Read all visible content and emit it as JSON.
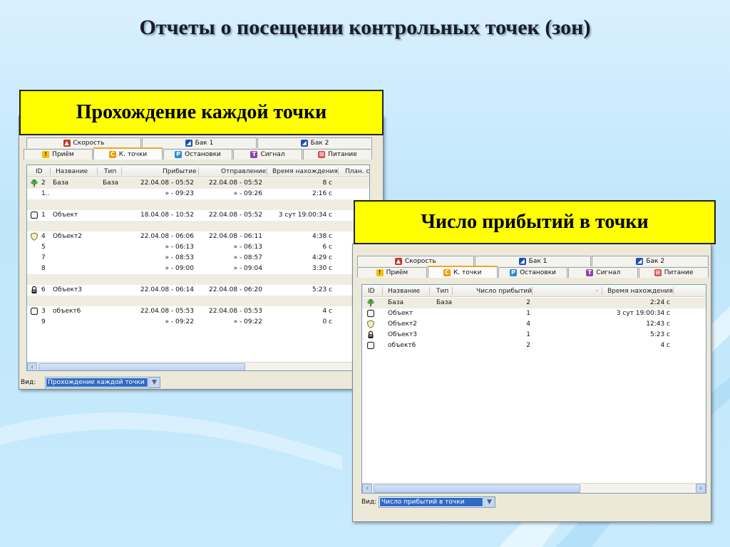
{
  "slide": {
    "title": "Отчеты о посещении контрольных точек (зон)",
    "banner_left": "Прохождение каждой точки",
    "banner_right": "Число прибытий в точки"
  },
  "tabs_top": [
    {
      "label": "Скорость",
      "icon": "speed-icon",
      "color": "#c0392b"
    },
    {
      "label": "Бак 1",
      "icon": "tank-icon",
      "color": "#1f4fb4"
    },
    {
      "label": "Бак 2",
      "icon": "tank-icon",
      "color": "#1f4fb4"
    }
  ],
  "tabs_bottom": [
    {
      "label": "Приём",
      "icon": "exclamation-icon",
      "glyph": "!",
      "color": "#f2c200"
    },
    {
      "label": "К. точки",
      "icon": "checkpoint-icon",
      "glyph": "C",
      "color": "#f29a00",
      "active": true
    },
    {
      "label": "Остановки",
      "icon": "parking-icon",
      "glyph": "P",
      "color": "#2a8bd8"
    },
    {
      "label": "Сигнал",
      "icon": "signal-icon",
      "glyph": "T",
      "color": "#8e44ad"
    },
    {
      "label": "Питание",
      "icon": "power-icon",
      "glyph": "⊞",
      "color": "#d9534f"
    }
  ],
  "left_window": {
    "columns": [
      "ID",
      "Название",
      "Тип",
      "Прибытие",
      "Отправление",
      "Время нахождения",
      "План. с"
    ],
    "rows": [
      {
        "icon": "tree-icon",
        "id": "2",
        "name": "База",
        "type": "База",
        "arrive": "22.04.08 - 05:52",
        "depart": "22.04.08 - 05:52",
        "duration": "8 с",
        "sel": true
      },
      {
        "icon": "",
        "id": "1..",
        "name": "",
        "type": "",
        "arrive": "» - 09:23",
        "depart": "» - 09:26",
        "duration": "2:16 с"
      },
      {
        "icon": "",
        "id": "",
        "name": "",
        "type": "",
        "arrive": "",
        "depart": "",
        "duration": "",
        "sel": true
      },
      {
        "icon": "square-icon",
        "id": "1",
        "name": "Объект",
        "type": "",
        "arrive": "18.04.08 - 10:52",
        "depart": "22.04.08 - 05:52",
        "duration": "3 сут 19:00:34 с"
      },
      {
        "icon": "",
        "id": "",
        "name": "",
        "type": "",
        "arrive": "",
        "depart": "",
        "duration": "",
        "sel": true
      },
      {
        "icon": "shield-icon",
        "id": "4",
        "name": "Объект2",
        "type": "",
        "arrive": "22.04.08 - 06:06",
        "depart": "22.04.08 - 06:11",
        "duration": "4:38 с"
      },
      {
        "icon": "",
        "id": "5",
        "name": "",
        "type": "",
        "arrive": "» - 06:13",
        "depart": "» - 06:13",
        "duration": "6 с"
      },
      {
        "icon": "",
        "id": "7",
        "name": "",
        "type": "",
        "arrive": "» - 08:53",
        "depart": "» - 08:57",
        "duration": "4:29 с"
      },
      {
        "icon": "",
        "id": "8",
        "name": "",
        "type": "",
        "arrive": "» - 09:00",
        "depart": "» - 09:04",
        "duration": "3:30 с"
      },
      {
        "icon": "",
        "id": "",
        "name": "",
        "type": "",
        "arrive": "",
        "depart": "",
        "duration": "",
        "sel": true
      },
      {
        "icon": "lock-icon",
        "id": "6",
        "name": "Объект3",
        "type": "",
        "arrive": "22.04.08 - 06:14",
        "depart": "22.04.08 - 06:20",
        "duration": "5:23 с"
      },
      {
        "icon": "",
        "id": "",
        "name": "",
        "type": "",
        "arrive": "",
        "depart": "",
        "duration": "",
        "sel": true
      },
      {
        "icon": "square-icon",
        "id": "3",
        "name": "объект6",
        "type": "",
        "arrive": "22.04.08 - 05:53",
        "depart": "22.04.08 - 05:53",
        "duration": "4 с"
      },
      {
        "icon": "",
        "id": "9",
        "name": "",
        "type": "",
        "arrive": "» - 09:22",
        "depart": "» - 09:22",
        "duration": "0 с"
      }
    ],
    "view_label": "Вид:",
    "view_value": "Прохождение каждой точки"
  },
  "right_window": {
    "columns": [
      "ID",
      "Название",
      "Тип",
      "Число прибытий",
      "·",
      "Время нахождения"
    ],
    "rows": [
      {
        "icon": "tree-icon",
        "name": "База",
        "type": "База",
        "count": "2",
        "duration": "2:24 с",
        "sel": true
      },
      {
        "icon": "square-icon",
        "name": "Объект",
        "type": "",
        "count": "1",
        "duration": "3 сут 19:00:34 с"
      },
      {
        "icon": "shield-icon",
        "name": "Объект2",
        "type": "",
        "count": "4",
        "duration": "12:43 с"
      },
      {
        "icon": "lock-icon",
        "name": "Объект3",
        "type": "",
        "count": "1",
        "duration": "5:23 с"
      },
      {
        "icon": "square-icon",
        "name": "объект6",
        "type": "",
        "count": "2",
        "duration": "4 с"
      }
    ],
    "view_label": "Вид:",
    "view_value": "Число прибытий в точки"
  }
}
